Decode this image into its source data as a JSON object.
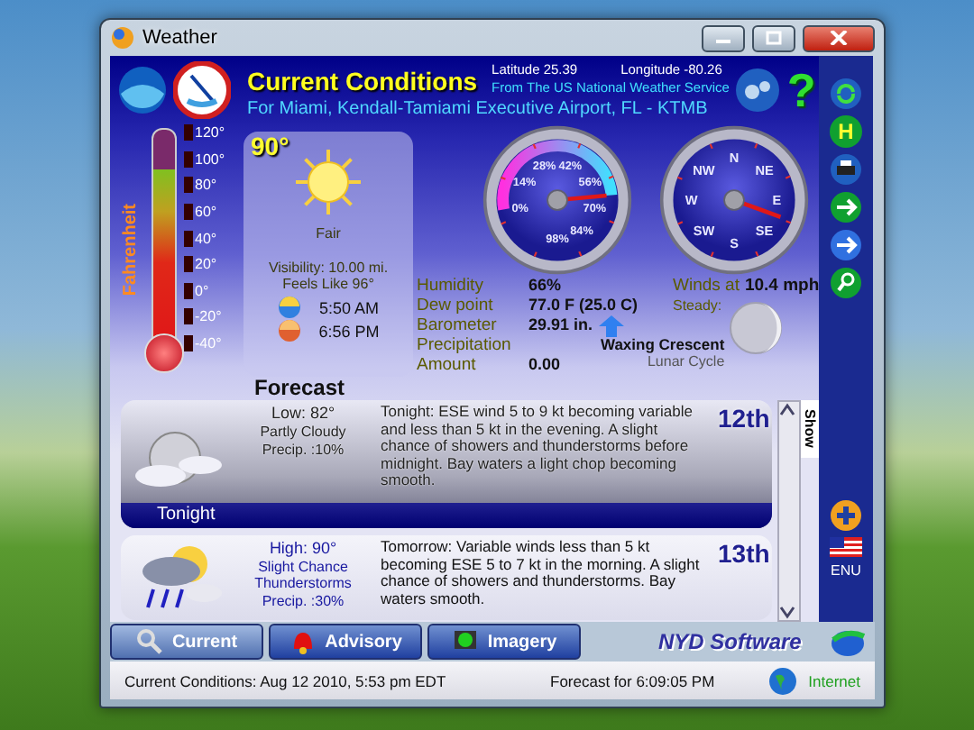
{
  "window": {
    "title": "Weather"
  },
  "header": {
    "title": "Current Conditions",
    "latitude": "Latitude 25.39",
    "longitude": "Longitude -80.26",
    "source": "From The US National Weather Service",
    "location": "For Miami, Kendall-Tamiami Executive Airport, FL - KTMB",
    "help": "?"
  },
  "thermometer": {
    "label": "Fahrenheit",
    "ticks": [
      "120°",
      "100°",
      "80°",
      "60°",
      "40°",
      "20°",
      "0°",
      "-20°",
      "-40°"
    ],
    "level": 0.81
  },
  "current": {
    "temperature": "90°",
    "condition": "Fair",
    "visibility": "Visibility: 10.00 mi.",
    "feels_like": "Feels Like 96°",
    "sunrise": "5:50 AM",
    "sunset": "6:56 PM"
  },
  "humidity_gauge": {
    "labels": [
      "0%",
      "14%",
      "28%",
      "42%",
      "56%",
      "70%",
      "84%",
      "98%"
    ],
    "level": 0.66
  },
  "wind_gauge": {
    "labels": [
      "N",
      "NE",
      "E",
      "SE",
      "S",
      "SW",
      "W",
      "NW"
    ]
  },
  "details": [
    {
      "label": "Humidity",
      "value": "66%"
    },
    {
      "label": "Dew point",
      "value": "77.0 F (25.0 C)"
    },
    {
      "label": "Barometer",
      "value": "29.91 in."
    },
    {
      "label": "Precipitation"
    },
    {
      "label": "Amount",
      "value": "0.00"
    }
  ],
  "wind": {
    "label": "Winds at",
    "speed": "10.4 mph",
    "trend": "Steady:"
  },
  "moon": {
    "phase": "Waxing Crescent",
    "caption": "Lunar Cycle"
  },
  "forecast": {
    "title": "Forecast",
    "show_tab": "Show",
    "periods": [
      {
        "name": "Tonight",
        "temp": "Low: 82°",
        "condition": "Partly Cloudy",
        "precip": "Precip. :10%",
        "text": "Tonight:  ESE wind 5 to 9 kt becoming variable and less than 5 kt in the evening. A slight chance of showers and thunderstorms before midnight.  Bay waters a light chop becoming  smooth.",
        "day": "12th",
        "selected": true
      },
      {
        "temp": "High: 90°",
        "condition": "Slight Chance Thunderstorms",
        "precip": "Precip. :30%",
        "text": "Tomorrow:  Variable winds less than 5 kt becoming ESE 5 to 7 kt in the morning. A slight chance of showers and thunderstorms.  Bay waters smooth.",
        "day": "13th",
        "selected": false
      }
    ]
  },
  "sidebar": {
    "letter_button": "H",
    "language": "ENU"
  },
  "tabs": [
    {
      "label": "Current",
      "selected": true
    },
    {
      "label": "Advisory",
      "selected": false
    },
    {
      "label": "Imagery",
      "selected": false
    }
  ],
  "brand": "NYD Software",
  "status_bar": {
    "conditions": "Current Conditions:  Aug 12 2010, 5:53 pm EDT",
    "forecast": "Forecast for 6:09:05 PM",
    "connection": "Internet"
  }
}
